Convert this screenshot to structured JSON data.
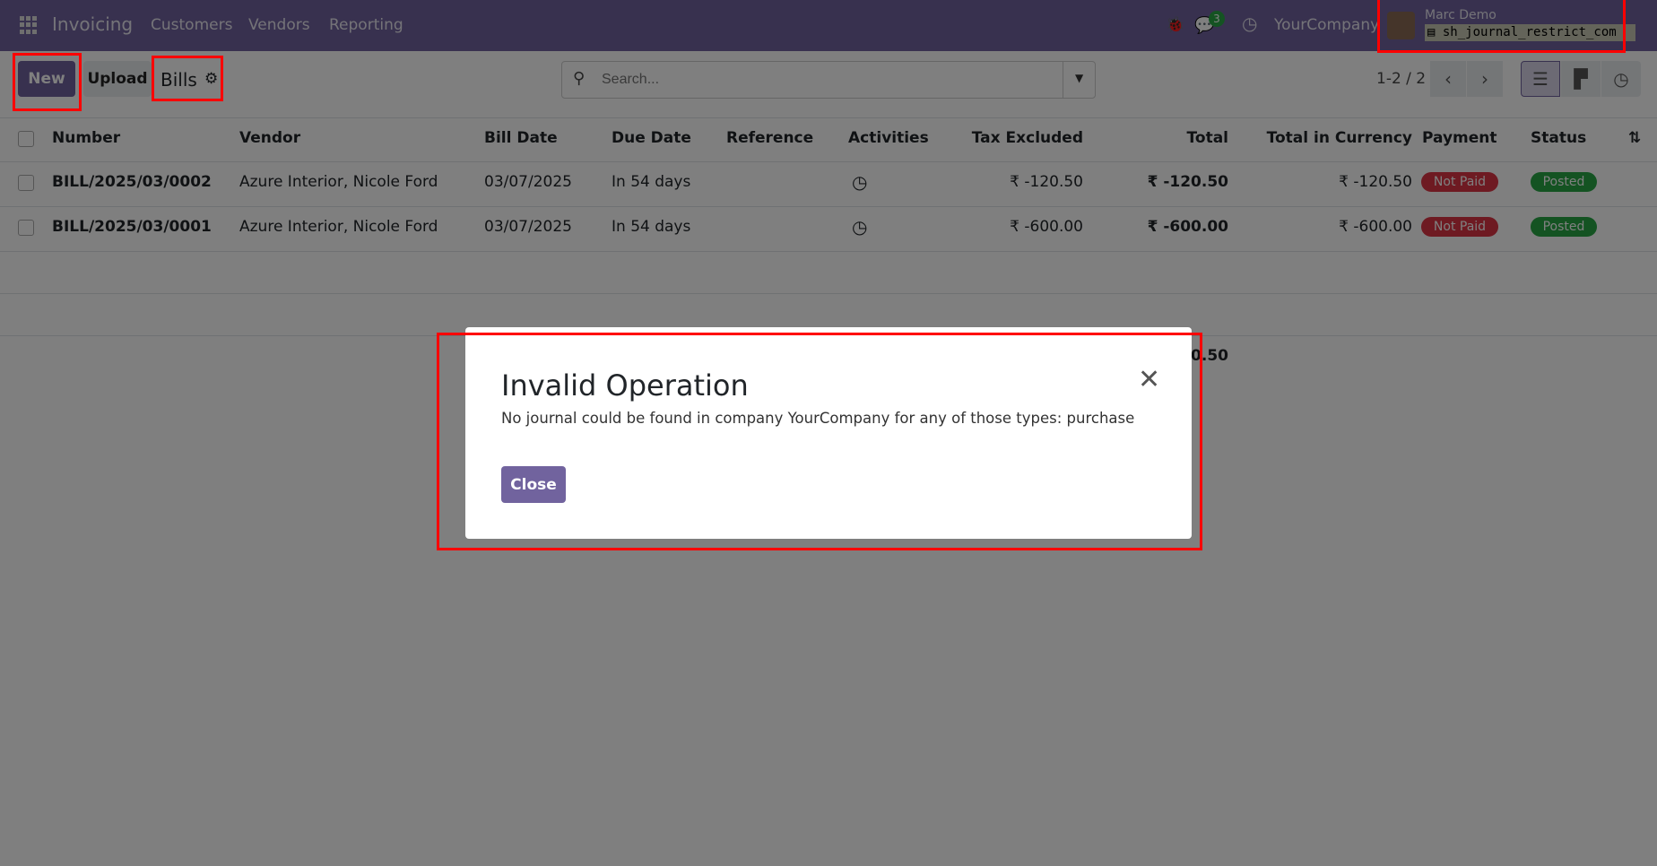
{
  "navbar": {
    "app_name": "Invoicing",
    "menu": [
      "Customers",
      "Vendors",
      "Reporting"
    ],
    "message_count": "3",
    "company": "YourCompany",
    "user_name": "Marc Demo",
    "database": "sh_journal_restrict_com",
    "accent": "#71639e"
  },
  "control_panel": {
    "new_label": "New",
    "upload_label": "Upload",
    "breadcrumb": "Bills",
    "search_placeholder": "Search...",
    "pager": "1-2 / 2"
  },
  "table": {
    "headers": [
      "Number",
      "Vendor",
      "Bill Date",
      "Due Date",
      "Reference",
      "Activities",
      "Tax Excluded",
      "Total",
      "Total in Currency",
      "Payment",
      "Status"
    ],
    "rows": [
      {
        "number": "BILL/2025/03/0002",
        "vendor": "Azure Interior, Nicole Ford",
        "bill_date": "03/07/2025",
        "due_date": "In 54 days",
        "reference": "",
        "tax_excluded": "₹ -120.50",
        "total": "₹ -120.50",
        "total_currency": "₹ -120.50",
        "payment": "Not Paid",
        "status": "Posted"
      },
      {
        "number": "BILL/2025/03/0001",
        "vendor": "Azure Interior, Nicole Ford",
        "bill_date": "03/07/2025",
        "due_date": "In 54 days",
        "reference": "",
        "tax_excluded": "₹ -600.00",
        "total": "₹ -600.00",
        "total_currency": "₹ -600.00",
        "payment": "Not Paid",
        "status": "Posted"
      }
    ],
    "footer_total": "-720.50"
  },
  "dialog": {
    "title": "Invalid Operation",
    "message": "No journal could be found in company YourCompany for any of those types: purchase",
    "close_label": "Close"
  }
}
